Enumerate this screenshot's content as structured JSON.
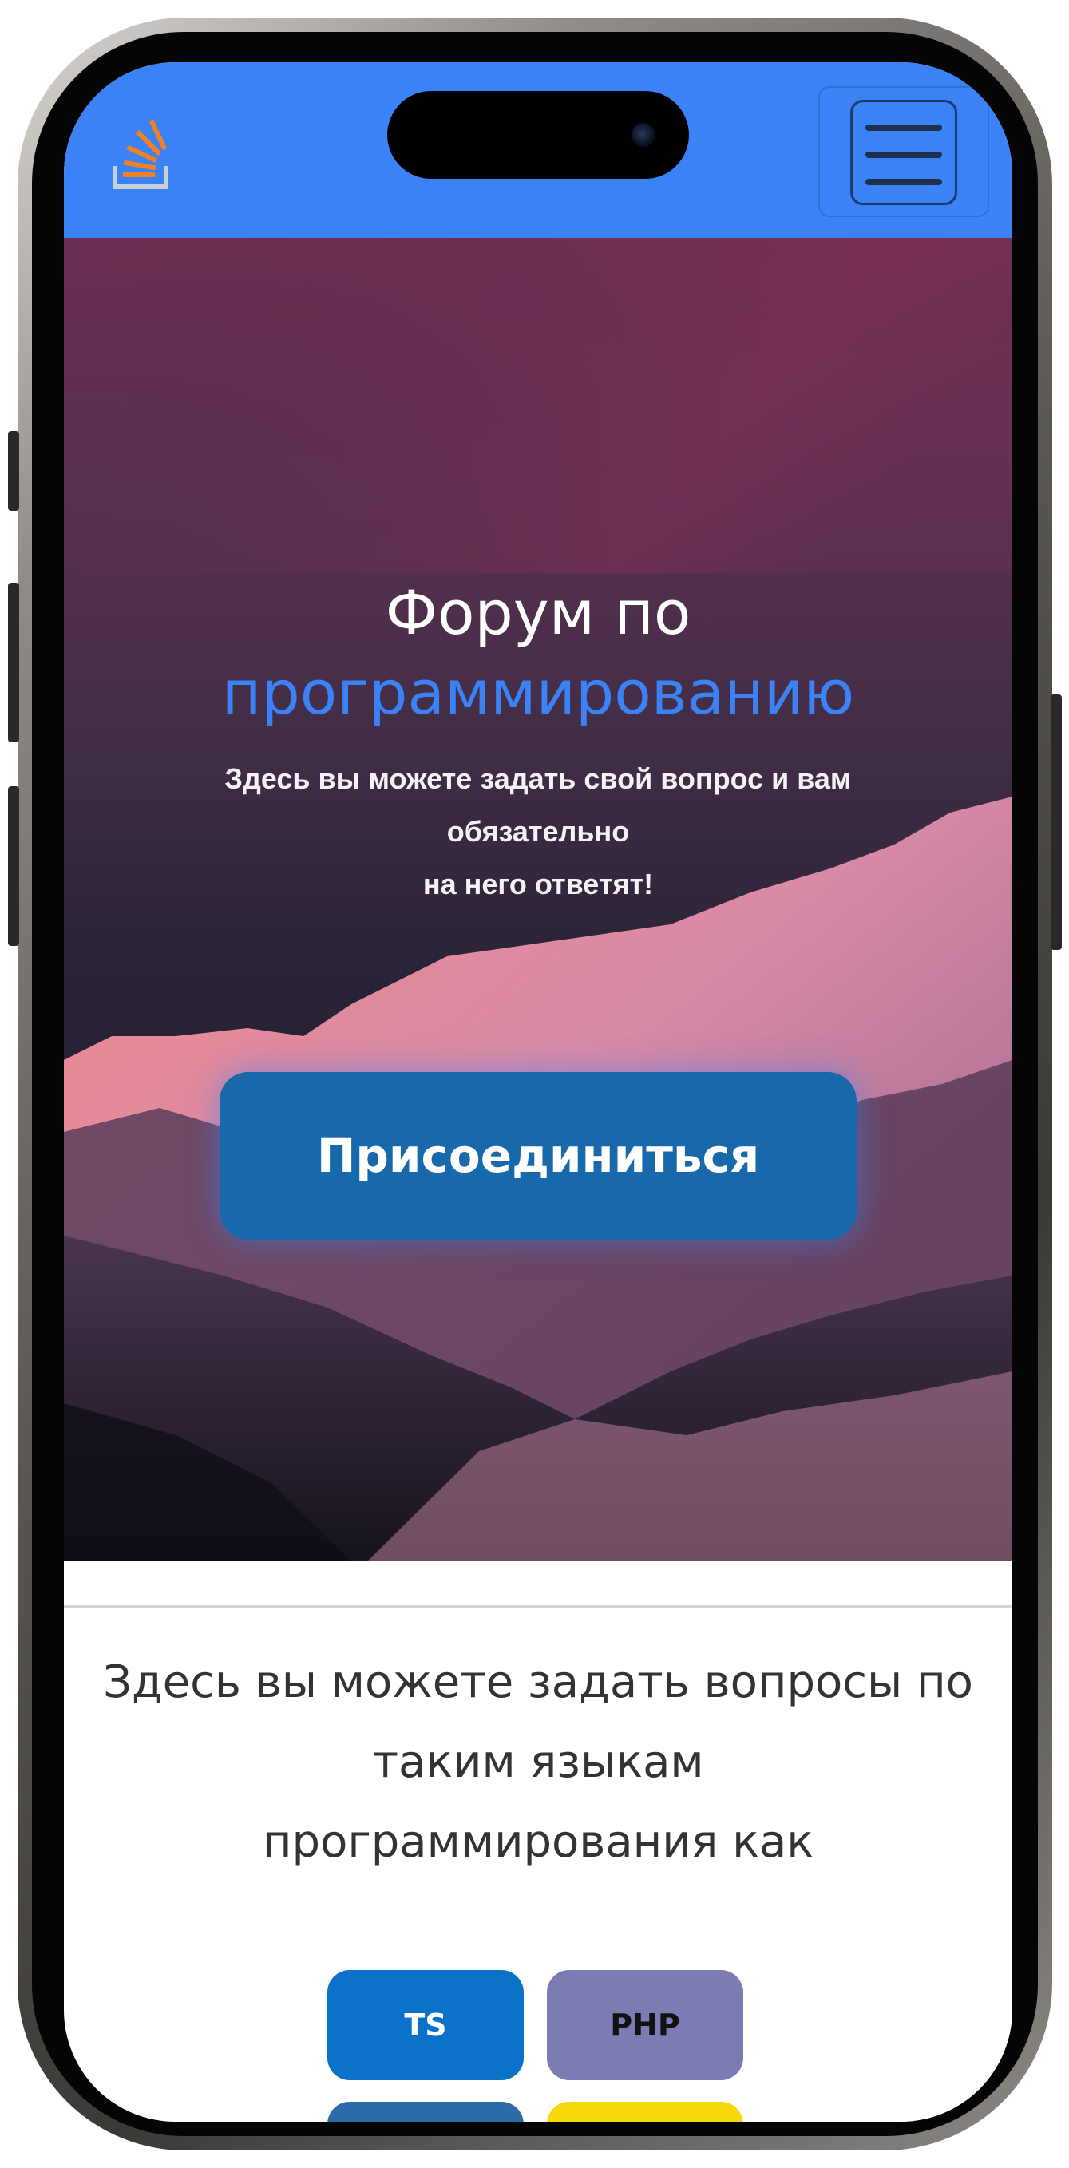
{
  "header": {
    "logo_icon": "stack-overflow-logo-icon",
    "menu_icon": "hamburger-menu-icon",
    "background_color": "#3b82f6"
  },
  "hero": {
    "title_line1": "Форум по",
    "title_line2": "программированию",
    "subtitle_line1": "Здесь вы можете задать свой вопрос и вам",
    "subtitle_line2": "обязательно",
    "subtitle_line3": "на него ответят!",
    "join_label": "Присоединиться",
    "accent_color": "#3b82f6",
    "button_color": "#1769ac"
  },
  "intro": {
    "line1": "Здесь вы можете задать вопросы по",
    "line2": "таким языкам",
    "line3": "программирования как"
  },
  "languages": [
    {
      "label": "TS",
      "color": "#0a73c9",
      "text_color": "#ffffff"
    },
    {
      "label": "PHP",
      "color": "#7a7cb3",
      "text_color": "#111111"
    },
    {
      "label": "",
      "color": "#2f6aa8",
      "text_color": "#ffffff"
    },
    {
      "label": "",
      "color": "#f5d90a",
      "text_color": "#111111"
    }
  ]
}
